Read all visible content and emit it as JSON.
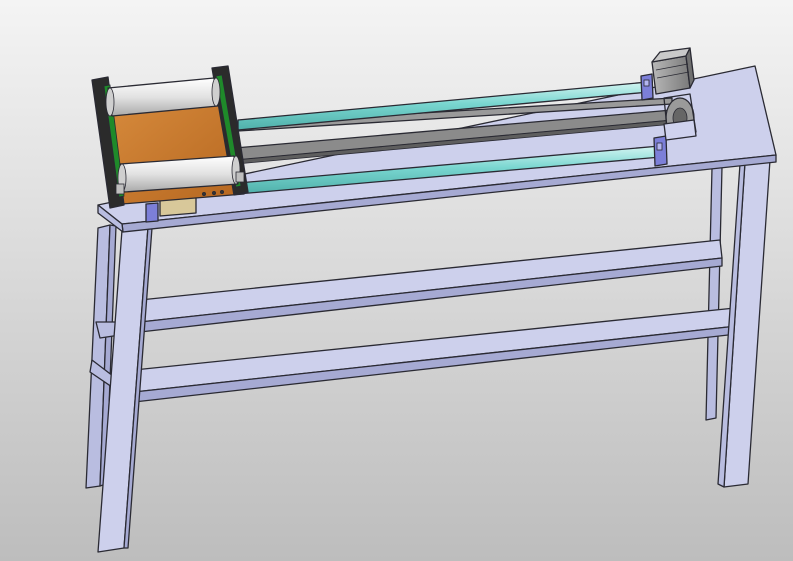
{
  "scene": {
    "view": "isometric-3d-cad-model",
    "subject": "linear-slide-on-bench-frame",
    "colors": {
      "background_top": "#f4f4f4",
      "background_bottom": "#bdbdbd",
      "frame_face": "#cdd0ec",
      "frame_side": "#b9bde0",
      "frame_shadow": "#a6aad3",
      "rail_glass": "#79d6d0",
      "rail_highlight": "#d4f5f2",
      "belt": "#8b8b8b",
      "carriage_plate": "#c8752c",
      "carriage_frame": "#2b2b2b",
      "carriage_trim": "#1f8a2a",
      "roller": "#e8e8e8",
      "bearing_block": "#7c7fd8",
      "motor_body": "#9a9a9a"
    },
    "parts": [
      "tabletop",
      "front-legs",
      "rear-legs",
      "cross-beams",
      "linear-rails",
      "timing-belt",
      "carriage",
      "stepper-motor",
      "pulley",
      "bearing-blocks"
    ]
  }
}
